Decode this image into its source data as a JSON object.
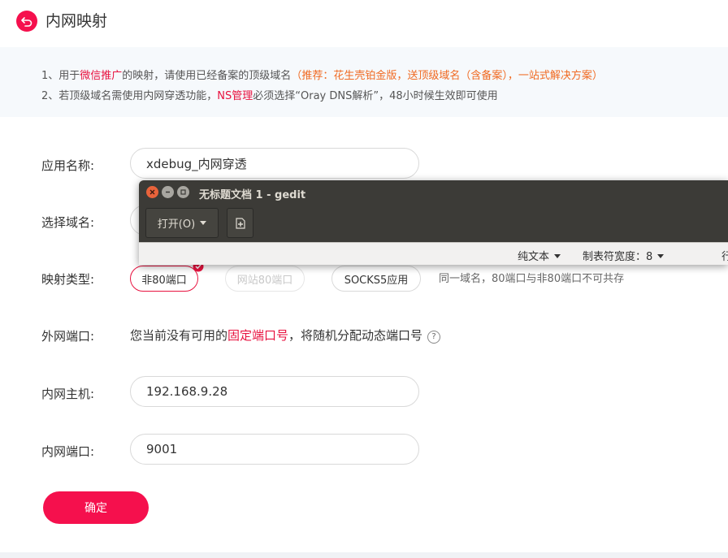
{
  "header": {
    "title": "内网映射",
    "back_icon": "back-arrow-icon",
    "accent": "#f5104d"
  },
  "notice": {
    "line1": {
      "p1": "1、用于",
      "link1": "微信推广",
      "p2": "的映射，请使用已经备案的顶级域名",
      "orange": "（推荐：花生壳铂金版，送顶级域名（含备案），一站式解决方案）"
    },
    "line2": {
      "p1": "2、若顶级域名需使用内网穿透功能，",
      "link1": "NS管理",
      "p2": "必须选择“Oray DNS解析”，48小时候生效即可使用"
    }
  },
  "form": {
    "app_name_label": "应用名称:",
    "app_name_value": "xdebug_内网穿透",
    "domain_label": "选择域名:",
    "type_label": "映射类型:",
    "types": [
      {
        "label": "非80端口",
        "state": "selected"
      },
      {
        "label": "网站80端口",
        "state": "disabled"
      },
      {
        "label": "SOCKS5应用",
        "state": "normal"
      }
    ],
    "type_hint": "同一域名，80端口与非80端口不可共存",
    "port_label": "外网端口:",
    "port_text_p1": "您当前没有可用的",
    "port_link": "固定端口号",
    "port_text_p2": "，将随机分配动态端口号",
    "help_glyph": "?",
    "host_label": "内网主机:",
    "host_value": "192.168.9.28",
    "inner_port_label": "内网端口:",
    "inner_port_value": "9001",
    "confirm": "确定"
  },
  "gedit": {
    "title": "无标题文档 1 - gedit",
    "open_label": "打开(O)",
    "new_tab_icon": "new-document-icon",
    "status_lang": "纯文本",
    "status_tab": "制表符宽度：8",
    "status_more": "行"
  }
}
